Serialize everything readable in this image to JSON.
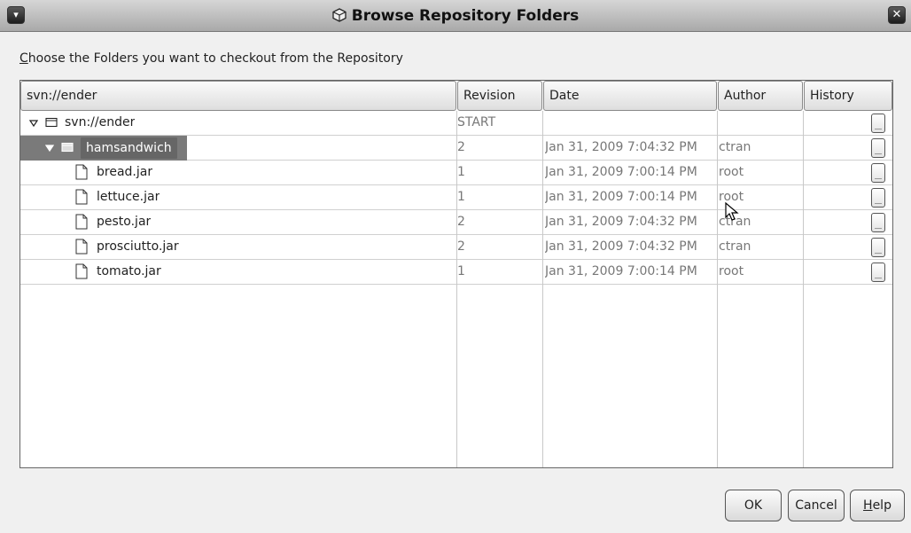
{
  "window": {
    "title": "Browse Repository Folders",
    "menu_glyph": "▾",
    "close_glyph": "✕",
    "icon": "repository-icon"
  },
  "prompt": {
    "mnemonic": "C",
    "rest": "hoose the Folders you want to checkout from the Repository"
  },
  "table": {
    "headers": {
      "name": "svn://ender",
      "revision": "Revision",
      "date": "Date",
      "author": "Author",
      "history": "History"
    },
    "rows": [
      {
        "name": "svn://ender",
        "revision": "START",
        "date": "",
        "author": "",
        "kind": "folder",
        "expanded": true,
        "level": 0,
        "selected": false
      },
      {
        "name": "hamsandwich",
        "revision": "2",
        "date": "Jan 31, 2009 7:04:32 PM",
        "author": "ctran",
        "kind": "folder",
        "expanded": true,
        "level": 1,
        "selected": true
      },
      {
        "name": "bread.jar",
        "revision": "1",
        "date": "Jan 31, 2009 7:00:14 PM",
        "author": "root",
        "kind": "file",
        "level": 2,
        "selected": false
      },
      {
        "name": "lettuce.jar",
        "revision": "1",
        "date": "Jan 31, 2009 7:00:14 PM",
        "author": "root",
        "kind": "file",
        "level": 2,
        "selected": false
      },
      {
        "name": "pesto.jar",
        "revision": "2",
        "date": "Jan 31, 2009 7:04:32 PM",
        "author": "ctran",
        "kind": "file",
        "level": 2,
        "selected": false
      },
      {
        "name": "prosciutto.jar",
        "revision": "2",
        "date": "Jan 31, 2009 7:04:32 PM",
        "author": "ctran",
        "kind": "file",
        "level": 2,
        "selected": false
      },
      {
        "name": "tomato.jar",
        "revision": "1",
        "date": "Jan 31, 2009 7:00:14 PM",
        "author": "root",
        "kind": "file",
        "level": 2,
        "selected": false
      }
    ]
  },
  "buttons": {
    "ok": "OK",
    "cancel": "Cancel",
    "help_mnemonic": "H",
    "help_rest": "elp"
  },
  "colors": {
    "selection": "#666666",
    "title_gradient_top": "#d6d6d6",
    "title_gradient_bottom": "#a9a9a9"
  }
}
